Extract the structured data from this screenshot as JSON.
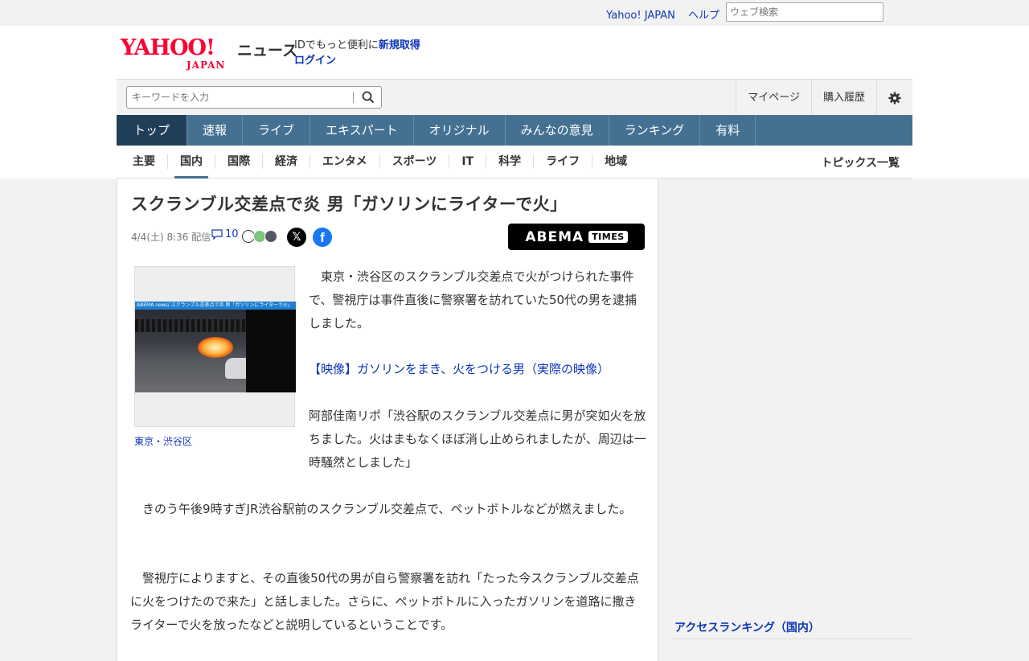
{
  "util": {
    "yahoo_japan": "Yahoo! JAPAN",
    "help": "ヘルプ",
    "web_search_placeholder": "ウェブ検索"
  },
  "header": {
    "logo_yahoo": "YAHOO!",
    "logo_japan": "JAPAN",
    "logo_news": "ニュース",
    "id_prompt": "IDでもっと便利に",
    "signup": "新規取得",
    "login": "ログイン"
  },
  "search": {
    "placeholder": "キーワードを入力"
  },
  "right_links": {
    "mypage": "マイページ",
    "history": "購入履歴"
  },
  "nav": [
    "トップ",
    "速報",
    "ライブ",
    "エキスパート",
    "オリジナル",
    "みんなの意見",
    "ランキング",
    "有料"
  ],
  "subnav": {
    "items": [
      "主要",
      "国内",
      "国際",
      "経済",
      "エンタメ",
      "スポーツ",
      "IT",
      "科学",
      "ライフ",
      "地域"
    ],
    "active": "国内",
    "topics": "トピックス一覧"
  },
  "article": {
    "title": "スクランブル交差点で炎 男「ガソリンにライターで火」",
    "date": "4/4(土) 8:36 配信",
    "comments": "10",
    "publisher_logo_main": "ABEMA",
    "publisher_logo_sub": "TIMES",
    "photo_banner": "ABEMA news/ スクランブル交差点で炎 男「ガソリンにライターで火」",
    "photo_caption": "東京・渋谷区",
    "p1": "東京・渋谷区のスクランブル交差点で火がつけられた事件で、警視庁は事件直後に警察署を訪れていた50代の男を逮捕しました。",
    "link": "【映像】ガソリンをまき、火をつける男（実際の映像）",
    "p2": "阿部佳南リポ「渋谷駅のスクランブル交差点に男が突如火を放ちました。火はまもなくほぼ消し止められましたが、周辺は一時騒然としました」",
    "p3": "きのう午後9時すぎJR渋谷駅前のスクランブル交差点で、ペットボトルなどが燃えました。",
    "p4": "警視庁によりますと、その直後50代の男が自ら警察署を訪れ「たった今スクランブル交差点に火をつけたので来た」と話しました。さらに、ペットボトルに入ったガソリンを道路に撒きライターで火を放ったなどと説明しているということです。"
  },
  "sidebar": {
    "ranking_title": "アクセスランキング（国内）"
  },
  "colors": {
    "nav_bg": "#447192",
    "nav_active": "#213e59",
    "link": "#0e36b8",
    "brand_red": "#ff0033"
  }
}
